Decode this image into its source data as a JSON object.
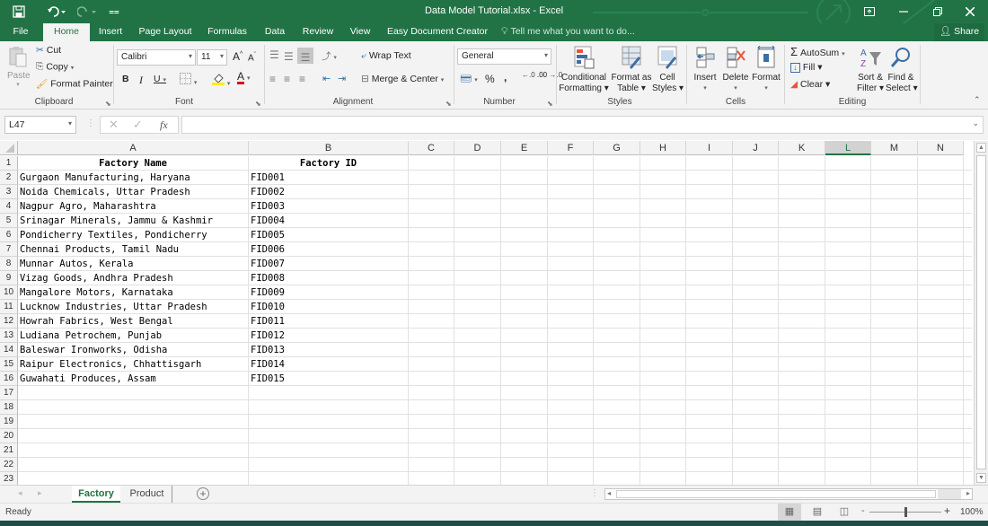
{
  "title_bar": {
    "title": "Data Model Tutorial.xlsx - Excel",
    "qat": [
      {
        "icon": "save-icon",
        "glyph": "🖫"
      },
      {
        "icon": "undo-icon",
        "glyph": "↶▾"
      },
      {
        "icon": "redo-icon",
        "glyph": "↷▾"
      },
      {
        "icon": "customize-qat-icon",
        "glyph": "="
      }
    ],
    "window_buttons": [
      {
        "icon": "ribbon-display-options-icon",
        "glyph": "⊡"
      },
      {
        "icon": "minimize-icon",
        "glyph": "—"
      },
      {
        "icon": "restore-icon",
        "glyph": "❐"
      },
      {
        "icon": "close-icon",
        "glyph": "✕"
      }
    ]
  },
  "ribbon_tabs": [
    "File",
    "Home",
    "Insert",
    "Page Layout",
    "Formulas",
    "Data",
    "Review",
    "View",
    "Easy Document Creator"
  ],
  "active_tab": "Home",
  "tell_me": "Tell me what you want to do...",
  "share_label": "Share",
  "ribbon": {
    "clipboard": {
      "label": "Clipboard",
      "paste": "Paste",
      "cut": "Cut",
      "copy": "Copy",
      "format_painter": "Format Painter"
    },
    "font": {
      "label": "Font",
      "font_name": "Calibri",
      "font_size": "11",
      "grow": "A",
      "shrink": "A",
      "bold": "B",
      "italic": "I",
      "underline": "U",
      "font_color_glyph": "A"
    },
    "alignment": {
      "label": "Alignment",
      "wrap_text": "Wrap Text",
      "merge_center": "Merge & Center"
    },
    "number": {
      "label": "Number",
      "format": "General",
      "percent": "%",
      "comma": ",",
      "inc_decimal": "←.0 .00",
      "dec_decimal": ".00 →.0"
    },
    "styles": {
      "label": "Styles",
      "conditional_formatting": [
        "Conditional",
        "Formatting ▾"
      ],
      "format_as_table": [
        "Format as",
        "Table ▾"
      ],
      "cell_styles": [
        "Cell",
        "Styles ▾"
      ]
    },
    "cells": {
      "label": "Cells",
      "insert": "Insert",
      "delete": "Delete",
      "format": "Format"
    },
    "editing": {
      "label": "Editing",
      "autosum": "AutoSum",
      "fill": "Fill ▾",
      "clear": "Clear ▾",
      "sort_filter": [
        "Sort &",
        "Filter ▾"
      ],
      "find_select": [
        "Find &",
        "Select ▾"
      ]
    }
  },
  "formula_bar": {
    "name_box": "L47",
    "fx": "fx",
    "formula": ""
  },
  "columns": [
    "A",
    "B",
    "C",
    "D",
    "E",
    "F",
    "G",
    "H",
    "I",
    "J",
    "K",
    "L",
    "M",
    "N"
  ],
  "selected_column": "L",
  "rows": [
    "1",
    "2",
    "3",
    "4",
    "5",
    "6",
    "7",
    "8",
    "9",
    "10",
    "11",
    "12",
    "13",
    "14",
    "15",
    "16",
    "17",
    "18",
    "19",
    "20",
    "21",
    "22",
    "23"
  ],
  "table": {
    "headers": [
      "Factory Name",
      "Factory ID"
    ],
    "rows": [
      [
        "Gurgaon Manufacturing, Haryana",
        "FID001"
      ],
      [
        "Noida Chemicals, Uttar Pradesh",
        "FID002"
      ],
      [
        "Nagpur Agro, Maharashtra",
        "FID003"
      ],
      [
        "Srinagar Minerals, Jammu & Kashmir",
        "FID004"
      ],
      [
        "Pondicherry Textiles, Pondicherry",
        "FID005"
      ],
      [
        "Chennai Products, Tamil Nadu",
        "FID006"
      ],
      [
        "Munnar Autos, Kerala",
        "FID007"
      ],
      [
        "Vizag Goods, Andhra Pradesh",
        "FID008"
      ],
      [
        "Mangalore Motors, Karnataka",
        "FID009"
      ],
      [
        "Lucknow Industries, Uttar Pradesh",
        "FID010"
      ],
      [
        "Howrah Fabrics, West Bengal",
        "FID011"
      ],
      [
        "Ludiana Petrochem, Punjab",
        "FID012"
      ],
      [
        "Baleswar Ironworks, Odisha",
        "FID013"
      ],
      [
        "Raipur Electronics, Chhattisgarh",
        "FID014"
      ],
      [
        "Guwahati Produces, Assam",
        "FID015"
      ]
    ]
  },
  "sheet_tabs": [
    "Factory",
    "Product"
  ],
  "active_sheet": "Factory",
  "status": {
    "text": "Ready",
    "zoom": "100%",
    "zoom_minus": "-",
    "zoom_plus": "+"
  },
  "colors": {
    "accent": "#217346",
    "ribbon_bg": "#f3f3f3"
  }
}
